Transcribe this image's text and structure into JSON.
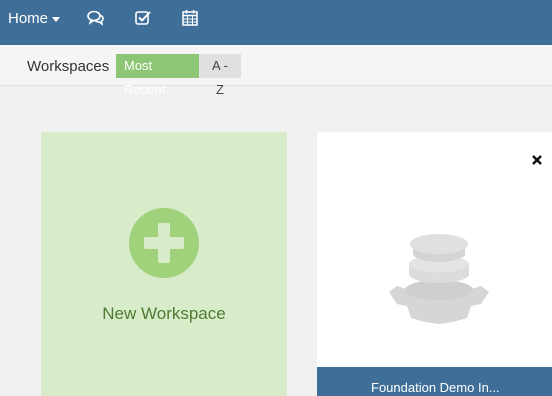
{
  "topnav": {
    "home_label": "Home",
    "icons": [
      "comments-icon",
      "tasks-check-icon",
      "calendar-icon"
    ],
    "background": "#3f6f98"
  },
  "subbar": {
    "title": "Workspaces",
    "sort_options": [
      {
        "label": "Most Recent",
        "active": true
      },
      {
        "label": "A - Z",
        "active": false
      }
    ],
    "active_color": "#8dc775"
  },
  "cards": {
    "new_workspace": {
      "label": "New Workspace",
      "color": "#d9ecc9"
    },
    "workspace": {
      "name": "Foundation Demo In...",
      "logo": "foundation-logo-icon"
    }
  }
}
